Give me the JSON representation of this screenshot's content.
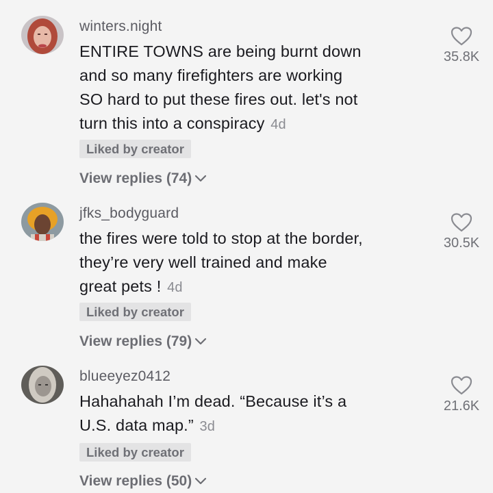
{
  "comments": [
    {
      "username": "winters.night",
      "lines": [
        "ENTIRE TOWNS are being burnt down",
        "and so many firefighters are working",
        "SO hard to put these fires out. let's not",
        "turn this into a conspiracy"
      ],
      "time": "4d",
      "liked_label": "Liked by creator",
      "replies_label": "View replies (74)",
      "likes": "35.8K",
      "avatar_colors": {
        "hair": "#b04a3b",
        "skin": "#e7b9a8",
        "bg": "#c9c3c6"
      }
    },
    {
      "username": "jfks_bodyguard",
      "lines": [
        "the fires were told to stop at the border,",
        "they’re very well trained and make",
        "great pets !"
      ],
      "time": "4d",
      "liked_label": "Liked by creator",
      "replies_label": "View replies (79)",
      "likes": "30.5K",
      "avatar_colors": {
        "hair": "#e7a126",
        "skin": "#6b4432",
        "bg": "#8d9aa1"
      }
    },
    {
      "username": "blueeyez0412",
      "lines": [
        "Hahahahah I’m dead. “Because it’s a",
        "U.S. data map.”"
      ],
      "time": "3d",
      "liked_label": "Liked by creator",
      "replies_label": "View replies (50)",
      "likes": "21.6K",
      "avatar_colors": {
        "hair": "#cfcac2",
        "skin": "#9c9690",
        "bg": "#5f5d59"
      }
    }
  ]
}
